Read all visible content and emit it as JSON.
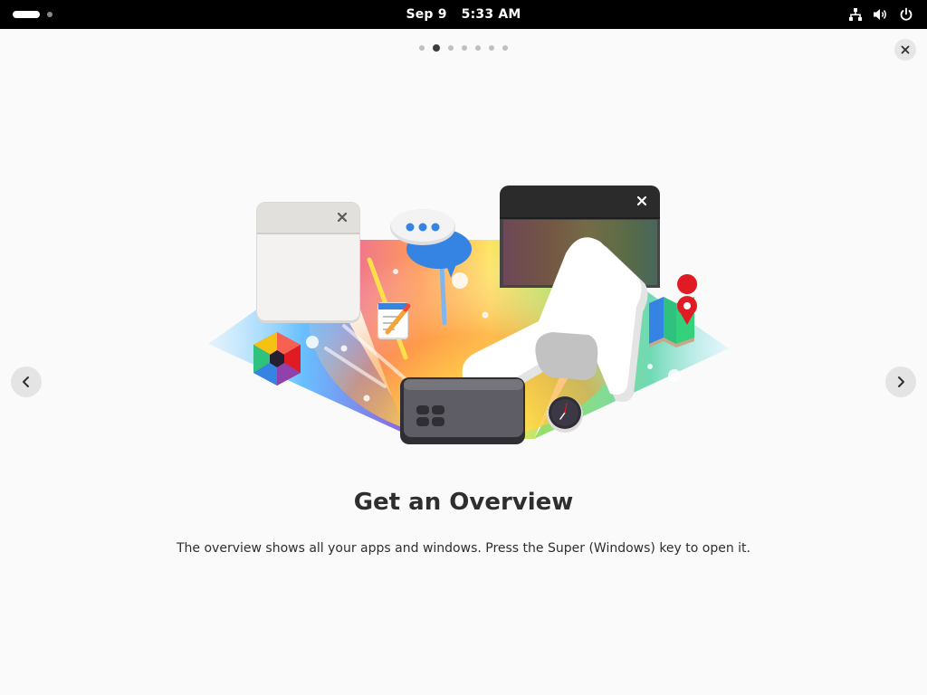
{
  "topbar": {
    "date": "Sep 9",
    "time": "5:33 AM",
    "icons": [
      "workspace-indicator",
      "network-wired-icon",
      "volume-icon",
      "power-icon"
    ]
  },
  "tour": {
    "page_count": 7,
    "current_page": 2,
    "title": "Get an Overview",
    "description": "The overview shows all your apps and windows. Press the Super (Windows) key to open it.",
    "icons": [
      "close-icon",
      "chevron-left-icon",
      "chevron-right-icon"
    ]
  },
  "colors": {
    "topbar_bg": "#000000",
    "page_bg": "#fafafa",
    "text": "#2e2e2e",
    "accent_blue": "#3584e4"
  }
}
